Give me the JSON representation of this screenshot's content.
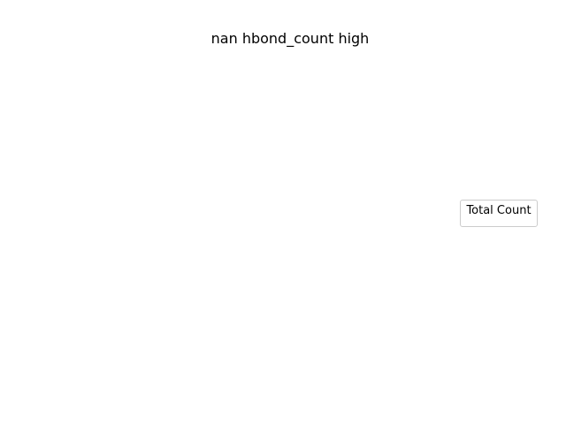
{
  "chart_data": {
    "type": "bar",
    "title": "nan hbond_count high",
    "legend": {
      "title": "Total Count",
      "placement": "center-right",
      "entries": []
    },
    "series": [],
    "categories": [],
    "axes_visible": false,
    "grid": false
  }
}
